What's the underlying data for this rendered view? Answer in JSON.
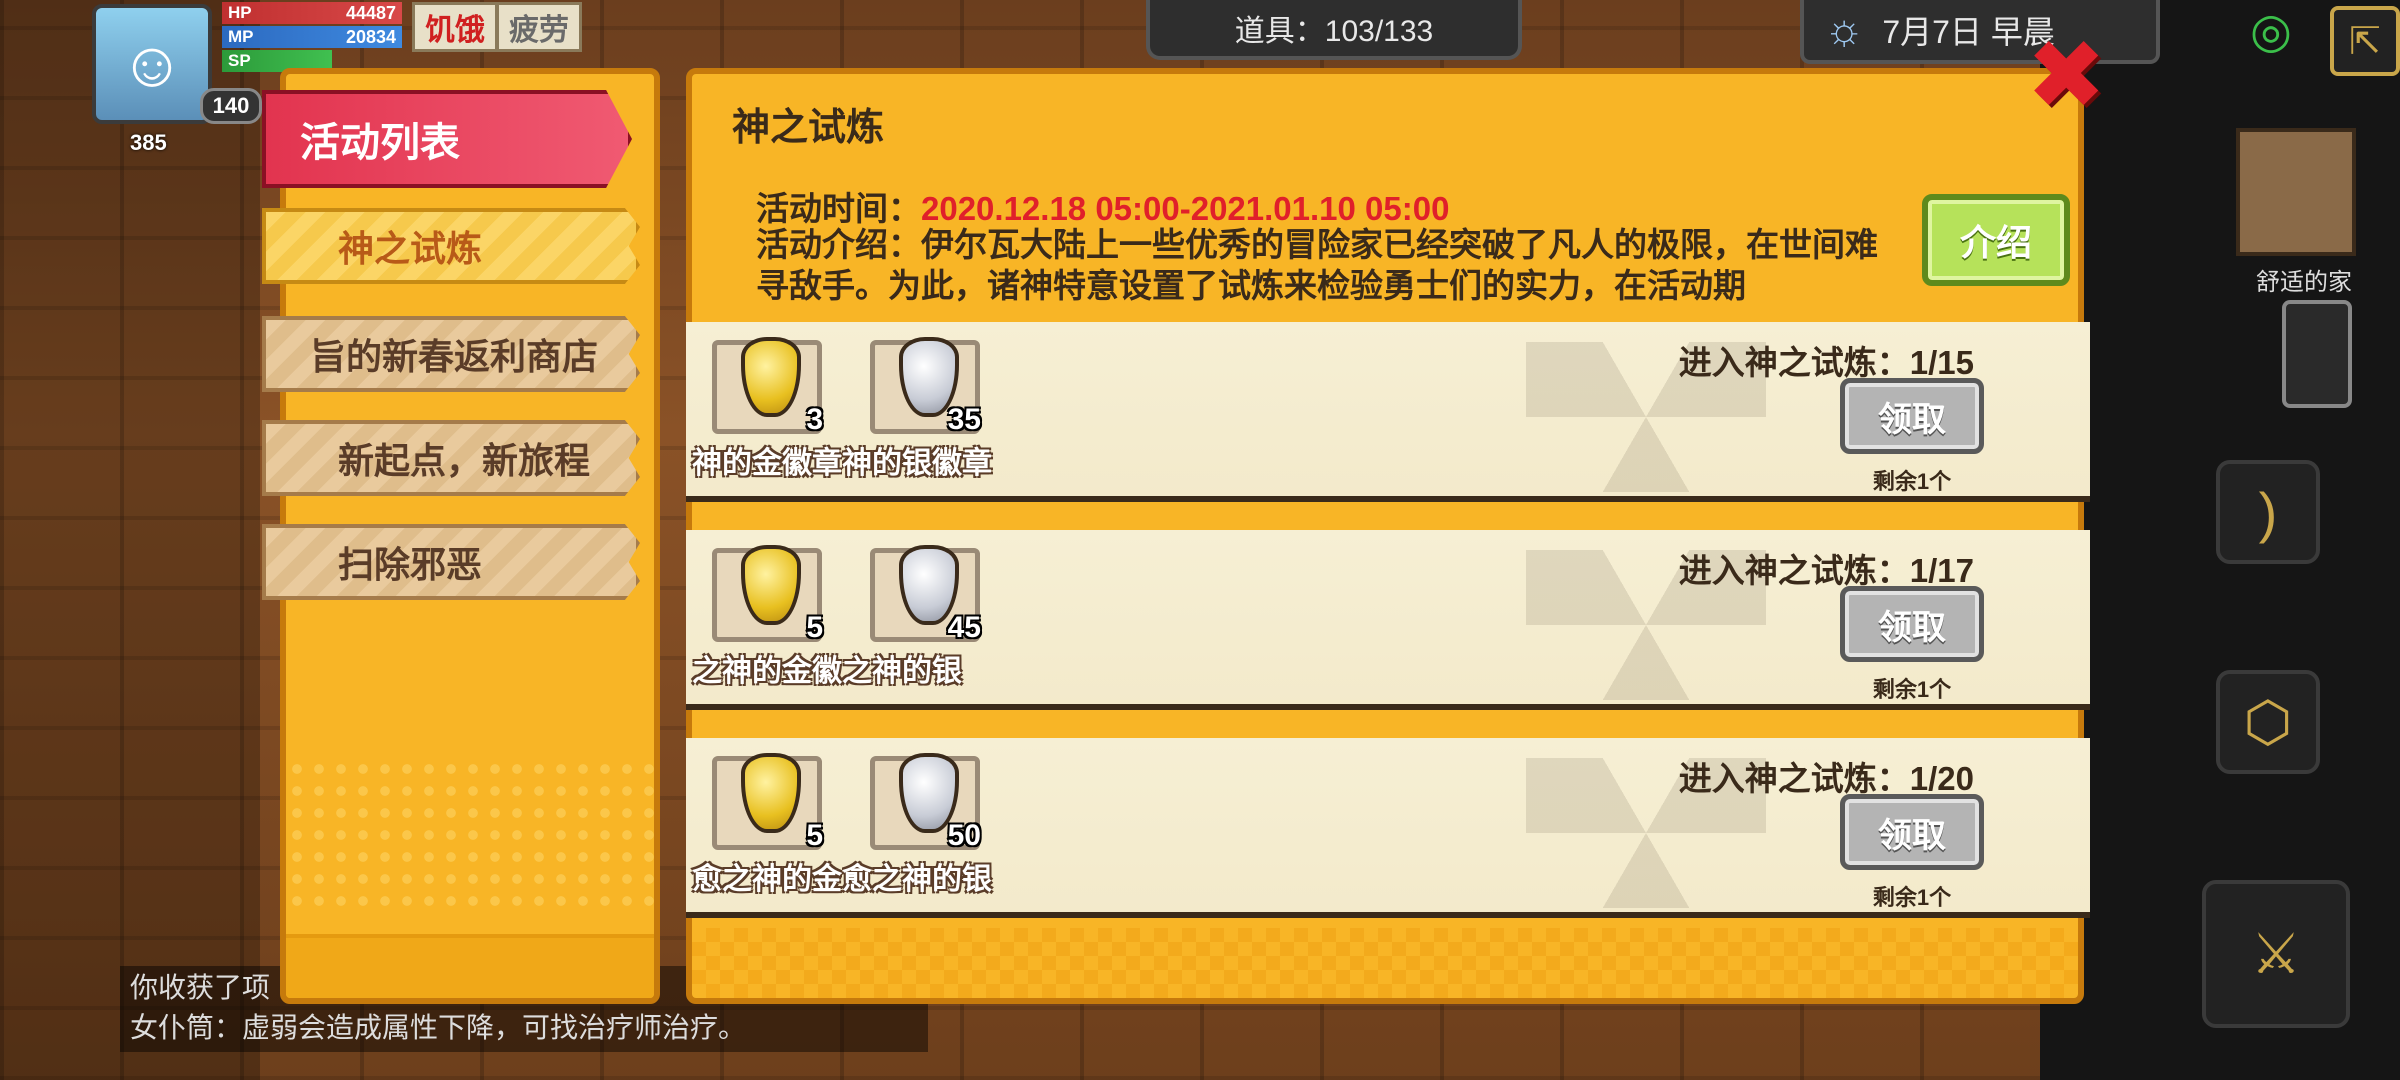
{
  "hud": {
    "hp_label": "HP",
    "hp_value": "44487",
    "mp_label": "MP",
    "mp_value": "20834",
    "sp_label": "SP",
    "level": "140",
    "status_tags": [
      "饥饿",
      "疲劳"
    ],
    "badges": [
      "385"
    ],
    "items_counter": "道具：103/133",
    "date": "7月7日 早晨",
    "home_label": "舒适的家"
  },
  "activity_list": {
    "header": "活动列表",
    "tabs": [
      {
        "label": "神之试炼",
        "active": true
      },
      {
        "label": "旨的新春返利商店",
        "active": false
      },
      {
        "label": "新起点，新旅程",
        "active": false
      },
      {
        "label": "扫除邪恶",
        "active": false
      }
    ]
  },
  "panel": {
    "title": "神之试炼",
    "time_label": "活动时间：",
    "time_value": "2020.12.18 05:00-2021.01.10 05:00",
    "desc": "活动介绍：伊尔瓦大陆上一些优秀的冒险家已经突破了凡人的极限，在世间难寻敌手。为此，诸神特意设置了试炼来检验勇士们的实力，在活动期",
    "intro_button": "介绍",
    "claim_label": "领取",
    "remaining_label": "剩余1个"
  },
  "rows": [
    {
      "progress": "进入神之试炼：1/15",
      "rewards": [
        {
          "name": "神的金徽章",
          "qty": "3",
          "kind": "gold"
        },
        {
          "name": "神的银徽章",
          "qty": "35",
          "kind": "silver"
        }
      ]
    },
    {
      "progress": "进入神之试炼：1/17",
      "rewards": [
        {
          "name": "之神的金徽",
          "qty": "5",
          "kind": "gold"
        },
        {
          "name": "之神的银",
          "qty": "45",
          "kind": "silver"
        }
      ]
    },
    {
      "progress": "进入神之试炼：1/20",
      "rewards": [
        {
          "name": "愈之神的金",
          "qty": "5",
          "kind": "gold"
        },
        {
          "name": "愈之神的银",
          "qty": "50",
          "kind": "silver"
        }
      ]
    }
  ],
  "chat": {
    "line1": "你收获了项",
    "line2": "女仆筒：虚弱会造成属性下降，可找治疗师治疗。"
  },
  "colors": {
    "panel_bg": "#f8b526",
    "header_red": "#e2344f",
    "time_red": "#e0202a",
    "intro_green": "#b6e25a",
    "claim_gray": "#b4b4b4"
  }
}
